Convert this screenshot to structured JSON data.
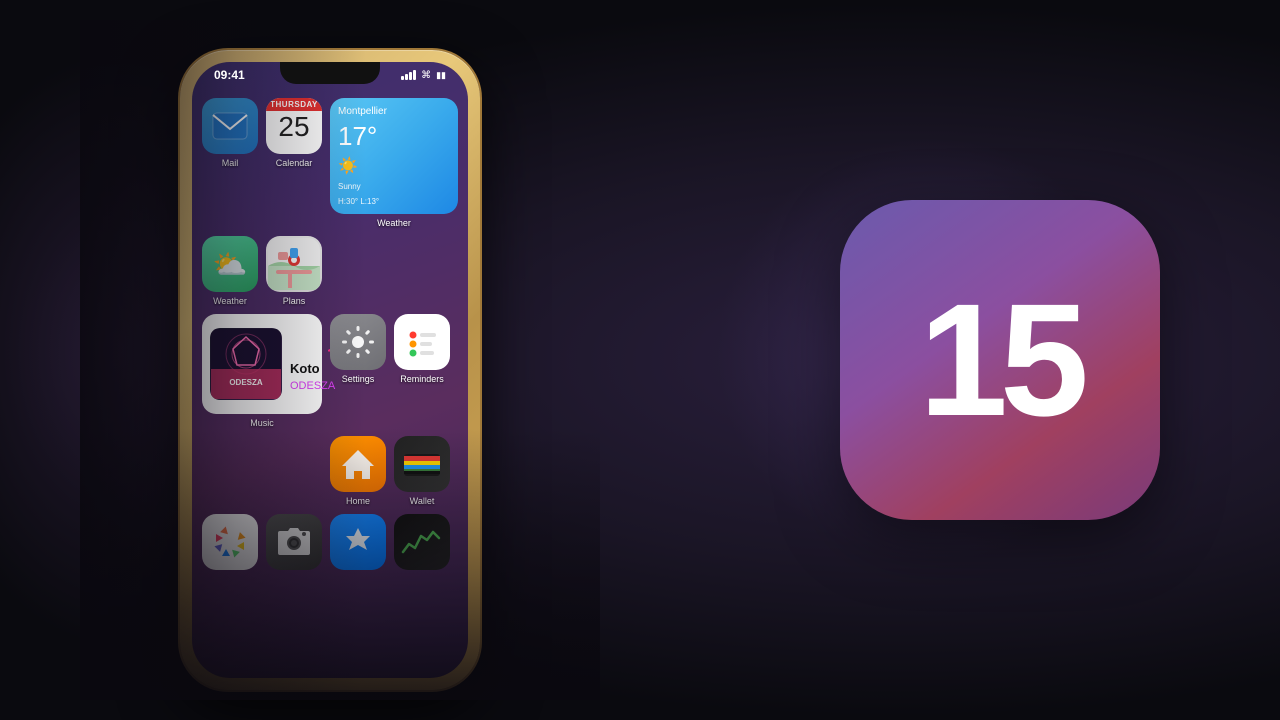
{
  "background": {
    "color": "#0a0a0f"
  },
  "ios15": {
    "number": "15",
    "corner_radius": "72px"
  },
  "phone": {
    "status_bar": {
      "time": "09:41",
      "signal": "●●●",
      "wifi": "wifi",
      "battery": "battery"
    },
    "apps": {
      "mail": {
        "label": "Mail"
      },
      "calendar": {
        "day": "THURSDAY",
        "date": "25",
        "label": "Calendar"
      },
      "weather_widget": {
        "city": "Montpellier",
        "temp": "17°",
        "condition": "Sunny",
        "high_low": "H:30° L:13°",
        "label": "Weather"
      },
      "weather_small": {
        "label": "Weather"
      },
      "plans": {
        "label": "Plans"
      },
      "music": {
        "track": "Koto",
        "artist": "ODESZA",
        "label": "Music"
      },
      "settings": {
        "label": "Settings"
      },
      "reminders": {
        "label": "Reminders"
      },
      "home": {
        "label": "Home"
      },
      "wallet": {
        "label": "Wallet"
      },
      "photos": {
        "label": "Photos"
      },
      "camera": {
        "label": "Camera"
      },
      "appstore": {
        "label": "App Store"
      },
      "stocks": {
        "label": "Stocks"
      }
    }
  }
}
